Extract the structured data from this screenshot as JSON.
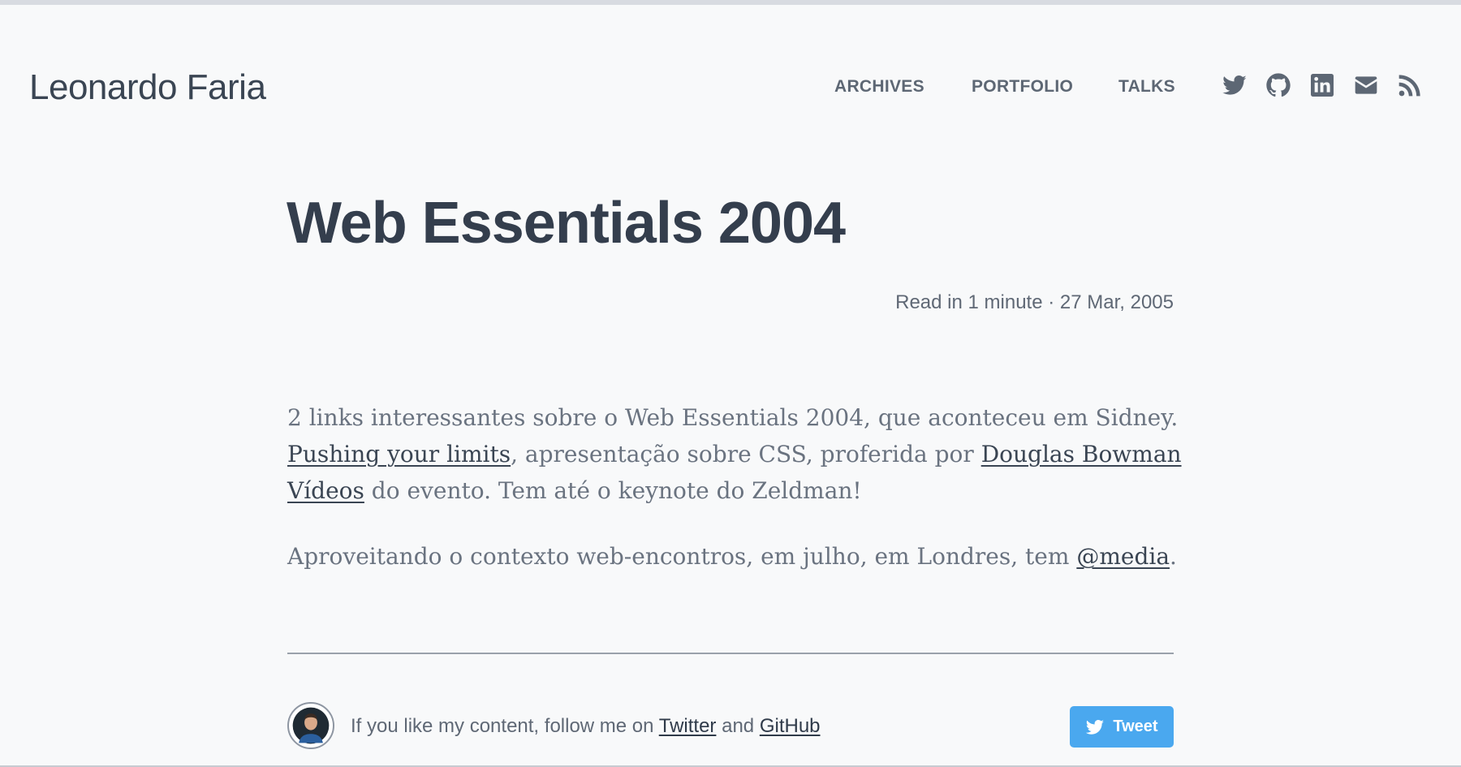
{
  "header": {
    "site_title": "Leonardo Faria",
    "nav": [
      "ARCHIVES",
      "PORTFOLIO",
      "TALKS"
    ],
    "social_icons": [
      "twitter-icon",
      "github-icon",
      "linkedin-icon",
      "mail-icon",
      "rss-icon"
    ]
  },
  "post": {
    "title": "Web Essentials 2004",
    "meta": "Read in 1 minute · 27 Mar, 2005",
    "p1_line1": "2 links interessantes sobre o Web Essentials 2004, que aconteceu em Sidney.",
    "p1_link1": "Pushing your limits",
    "p1_text2": ", apresentação sobre CSS, proferida por ",
    "p1_link2": "Douglas Bowman",
    "p1_link3": "Vídeos",
    "p1_text3": " do evento. Tem até o keynote do Zeldman!",
    "p2_text1": "Aproveitando o contexto web-encontros, em julho, em Londres, tem ",
    "p2_link": "@media",
    "p2_text2": "."
  },
  "footer": {
    "follow_text1": "If you like my content, follow me on ",
    "twitter_link": "Twitter",
    "follow_text2": " and ",
    "github_link": "GitHub",
    "tweet_label": "Tweet"
  },
  "colors": {
    "background": "#f8f9fa",
    "text_dark": "#343e4d",
    "text_muted": "#5f6875",
    "tweet_button": "#4aa8ef"
  }
}
